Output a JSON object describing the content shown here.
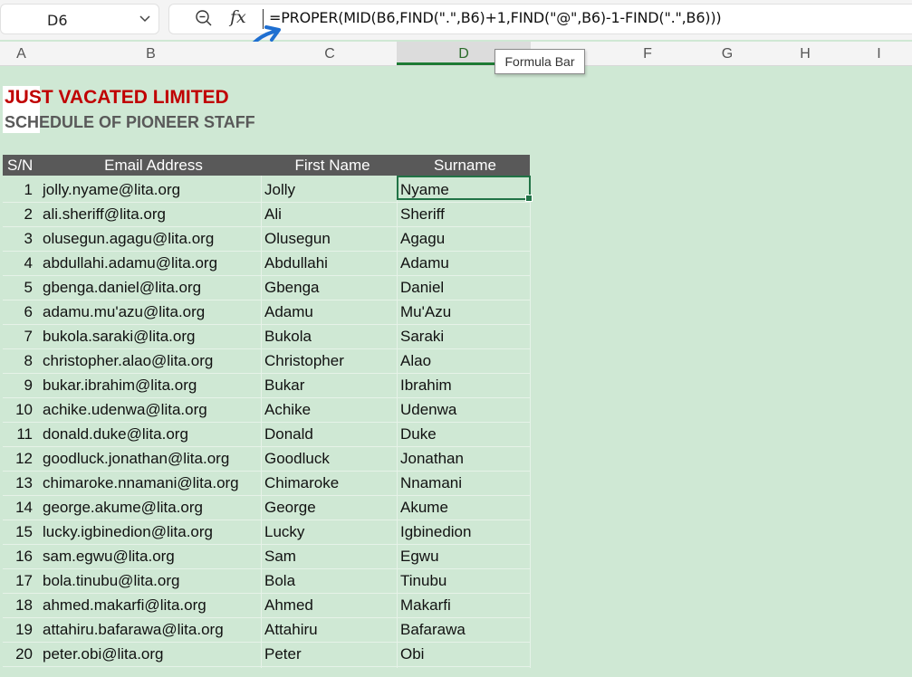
{
  "namebox": {
    "cell_ref": "D6"
  },
  "formula_bar": {
    "formula": "=PROPER(MID(B6,FIND(\".\",B6)+1,FIND(\"@\",B6)-1-FIND(\".\",B6)))"
  },
  "tooltip": {
    "text": "Formula Bar"
  },
  "columns": [
    "A",
    "B",
    "C",
    "D",
    "F",
    "G",
    "H",
    "I"
  ],
  "sheet": {
    "title": "JUST VACATED LIMITED",
    "subtitle": "SCHEDULE OF PIONEER STAFF",
    "headers": {
      "sn": "S/N",
      "email": "Email Address",
      "first": "First Name",
      "surname": "Surname"
    },
    "rows": [
      {
        "sn": "1",
        "email": "jolly.nyame@lita.org",
        "first": "Jolly",
        "surname": "Nyame"
      },
      {
        "sn": "2",
        "email": "ali.sheriff@lita.org",
        "first": "Ali",
        "surname": "Sheriff"
      },
      {
        "sn": "3",
        "email": "olusegun.agagu@lita.org",
        "first": "Olusegun",
        "surname": "Agagu"
      },
      {
        "sn": "4",
        "email": "abdullahi.adamu@lita.org",
        "first": "Abdullahi",
        "surname": "Adamu"
      },
      {
        "sn": "5",
        "email": "gbenga.daniel@lita.org",
        "first": "Gbenga",
        "surname": "Daniel"
      },
      {
        "sn": "6",
        "email": "adamu.mu'azu@lita.org",
        "first": "Adamu",
        "surname": "Mu'Azu"
      },
      {
        "sn": "7",
        "email": "bukola.saraki@lita.org",
        "first": "Bukola",
        "surname": "Saraki"
      },
      {
        "sn": "8",
        "email": "christopher.alao@lita.org",
        "first": "Christopher",
        "surname": "Alao"
      },
      {
        "sn": "9",
        "email": "bukar.ibrahim@lita.org",
        "first": "Bukar",
        "surname": "Ibrahim"
      },
      {
        "sn": "10",
        "email": "achike.udenwa@lita.org",
        "first": "Achike",
        "surname": "Udenwa"
      },
      {
        "sn": "11",
        "email": "donald.duke@lita.org",
        "first": "Donald",
        "surname": "Duke"
      },
      {
        "sn": "12",
        "email": "goodluck.jonathan@lita.org",
        "first": "Goodluck",
        "surname": "Jonathan"
      },
      {
        "sn": "13",
        "email": "chimaroke.nnamani@lita.org",
        "first": "Chimaroke",
        "surname": "Nnamani"
      },
      {
        "sn": "14",
        "email": "george.akume@lita.org",
        "first": "George",
        "surname": "Akume"
      },
      {
        "sn": "15",
        "email": "lucky.igbinedion@lita.org",
        "first": "Lucky",
        "surname": "Igbinedion"
      },
      {
        "sn": "16",
        "email": "sam.egwu@lita.org",
        "first": "Sam",
        "surname": "Egwu"
      },
      {
        "sn": "17",
        "email": "bola.tinubu@lita.org",
        "first": "Bola",
        "surname": "Tinubu"
      },
      {
        "sn": "18",
        "email": "ahmed.makarfi@lita.org",
        "first": "Ahmed",
        "surname": "Makarfi"
      },
      {
        "sn": "19",
        "email": "attahiru.bafarawa@lita.org",
        "first": "Attahiru",
        "surname": "Bafarawa"
      },
      {
        "sn": "20",
        "email": "peter.obi@lita.org",
        "first": "Peter",
        "surname": "Obi"
      }
    ]
  },
  "colors": {
    "title": "#c00000",
    "subtitle": "#595959",
    "header_bg": "#595959",
    "sheet_bg": "#cfe8d4",
    "selection": "#217346",
    "arrow": "#1f6fd1"
  }
}
